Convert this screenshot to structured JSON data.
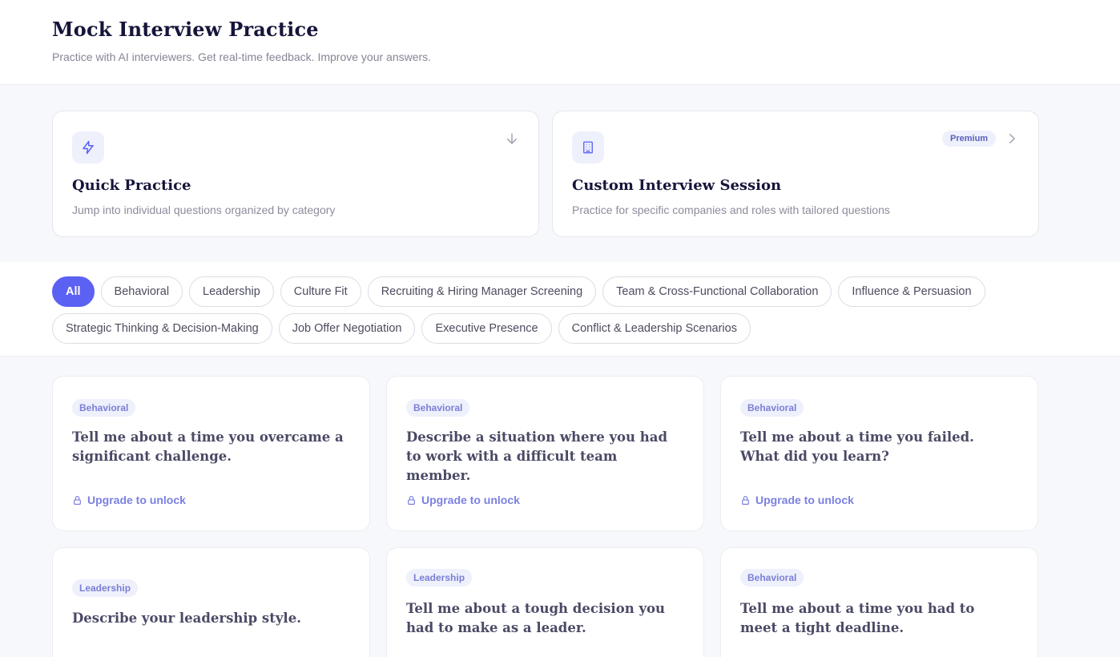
{
  "header": {
    "title": "Mock Interview Practice",
    "subtitle": "Practice with AI interviewers. Get real-time feedback. Improve your answers."
  },
  "modes": {
    "quick": {
      "icon": "lightning-icon",
      "title": "Quick Practice",
      "description": "Jump into individual questions organized by category",
      "action_icon": "arrow-down-icon"
    },
    "custom": {
      "icon": "building-icon",
      "title": "Custom Interview Session",
      "description": "Practice for specific companies and roles with tailored questions",
      "badge": "Premium",
      "action_icon": "chevron-right-icon"
    }
  },
  "filters": {
    "active": "All",
    "items": [
      "All",
      "Behavioral",
      "Leadership",
      "Culture Fit",
      "Recruiting & Hiring Manager Screening",
      "Team & Cross-Functional Collaboration",
      "Influence & Persuasion",
      "Strategic Thinking & Decision-Making",
      "Job Offer Negotiation",
      "Executive Presence",
      "Conflict & Leadership Scenarios"
    ]
  },
  "questions": [
    {
      "category": "Behavioral",
      "text": "Tell me about a time you overcame a significant challenge.",
      "action": "Upgrade to unlock",
      "locked": true
    },
    {
      "category": "Behavioral",
      "text": "Describe a situation where you had to work with a difficult team member.",
      "action": "Upgrade to unlock",
      "locked": true
    },
    {
      "category": "Behavioral",
      "text": "Tell me about a time you failed. What did you learn?",
      "action": "Upgrade to unlock",
      "locked": true
    },
    {
      "category": "Leadership",
      "text": "Describe your leadership style."
    },
    {
      "category": "Leadership",
      "text": "Tell me about a tough decision you had to make as a leader."
    },
    {
      "category": "Behavioral",
      "text": "Tell me about a time you had to meet a tight deadline."
    }
  ],
  "colors": {
    "accent": "#5b61f2",
    "tag_bg": "#eef0fc",
    "tag_text": "#7a7fd4",
    "unlock_text": "#7b80e0"
  }
}
